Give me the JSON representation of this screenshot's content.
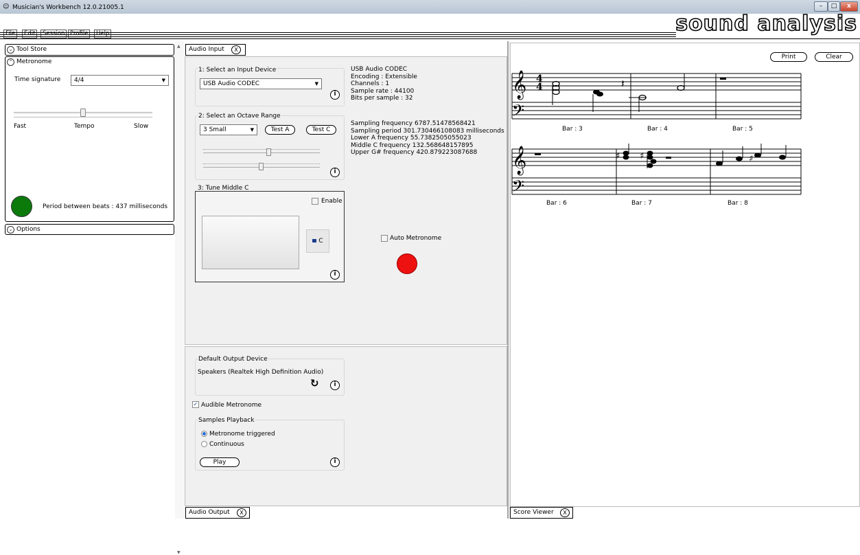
{
  "window": {
    "title": "Musician's Workbench 12.0.21005.1",
    "logo": "sound analysis",
    "controls": [
      "–",
      "□",
      "x"
    ]
  },
  "menu": [
    "File",
    "Edit",
    "Session",
    "Profile",
    "Help"
  ],
  "left": {
    "tool_store": "Tool Store",
    "metronome": {
      "header": "Metronome",
      "time_signature_label": "Time signature",
      "time_signature_value": "4/4",
      "slider_value": 0.5,
      "tempo_fast": "Fast",
      "tempo_label": "Tempo",
      "tempo_slow": "Slow",
      "period_text": "Period between beats : 437 milliseconds",
      "beat_color": "#0b7a0b"
    },
    "options": "Options"
  },
  "audio_input": {
    "tab": "Audio Input",
    "tab_close": "X",
    "device_group": "1: Select an Input Device",
    "device_value": "USB Audio CODEC",
    "octave_group": "2: Select an Octave Range",
    "octave_value": "3  Small",
    "test_a": "Test A",
    "test_c": "Test C",
    "tune_group": "3: Tune Middle C",
    "enable_label": "Enable",
    "c_button": "C",
    "info_glyph": "i",
    "device_info": [
      "USB Audio CODEC",
      "Encoding      : Extensible",
      "Channels      : 1",
      "Sample rate   : 44100",
      "Bits per sample : 32"
    ],
    "freq_info": [
      "Sampling frequency 6787.51478568421",
      "Sampling period 301.730466108083 milliseconds",
      "Lower A frequency 55.7382505055023",
      "Middle C frequency 132.568648157895",
      "Upper G# frequency 420.879223087688"
    ],
    "auto_metronome": "Auto Metronome",
    "indicator_color": "#ee1111"
  },
  "audio_output": {
    "tab": "Audio Output",
    "tab_close": "X",
    "default_group": "Default Output Device",
    "device": "Speakers (Realtek High Definition Audio)",
    "refresh_glyph": "↻",
    "audible_label": "Audible Metronome",
    "audible_checked": "✓",
    "samples_group": "Samples Playback",
    "radio_triggered": "Metronome triggered",
    "radio_continuous": "Continuous",
    "play": "Play"
  },
  "score_viewer": {
    "tab": "Score Viewer",
    "tab_close": "X",
    "print": "Print",
    "clear": "Clear",
    "time_sig": [
      "4",
      "4"
    ],
    "bars_row1": [
      "Bar : 3",
      "Bar : 4",
      "Bar : 5"
    ],
    "bars_row2": [
      "Bar : 6",
      "Bar : 7",
      "Bar : 8"
    ],
    "sharp": "♯"
  }
}
